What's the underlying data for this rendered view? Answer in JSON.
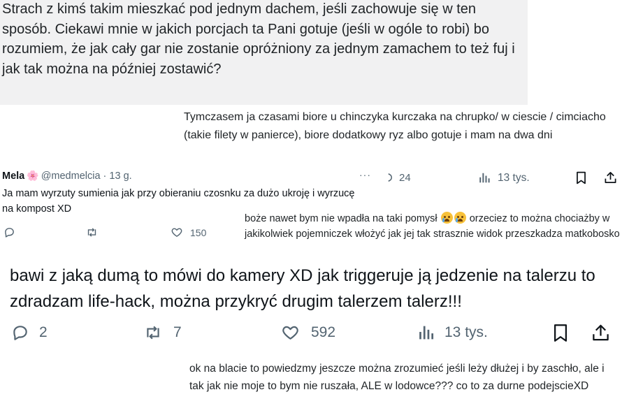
{
  "block1": {
    "text": "Strach z kimś takim mieszkać pod jednym dachem, jeśli zachowuje się w ten sposób. Ciekawi mnie w jakich porcjach ta Pani gotuje (jeśli w ogóle to robi) bo rozumiem, że jak cały gar nie zostanie opróżniony za jednym zamachem to też fuj i jak tak można na później zostawić?"
  },
  "block2": {
    "text": "Tymczasem ja czasami biore u chinczyka kurczaka na chrupko/ w ciescie / cimciacho (takie filety w panierce), biore dodatkowy ryz albo gotuje i mam na dwa dni"
  },
  "tweet_mela": {
    "name": "Mela",
    "flower": "🌸",
    "handle": "@medmelcia",
    "separator": "·",
    "time": "13 g.",
    "more": "···",
    "text": "Ja mam wyrzuty sumienia jak przy obieraniu czosnku za dużo ukroję i wyrzucę na kompost XD",
    "likes": "150"
  },
  "right_strip": {
    "replies": "24",
    "views": "13 tys."
  },
  "block5": {
    "text_before": "boże nawet bym nie wpadła na taki pomysł",
    "text_after": "orzeciez to można chociażby w jakikolwiek pojemniczek włożyć jak jej tak strasznie widok przeszkadza matkobosko"
  },
  "big_tweet": {
    "text": "bawi z jaką dumą to mówi do kamery XD jak triggeruje ją jedzenie na talerzu to zdradzam life-hack, można przykryć drugim talerzem talerz!!!",
    "replies": "2",
    "reposts": "7",
    "likes": "592",
    "views": "13 tys."
  },
  "block7": {
    "text": "ok na blacie to powiedzmy jeszcze można zrozumieć jeśli leży dłużej i by zaschło, ale i tak jak nie moje to bym nie ruszała, ALE w lodowce??? co to za durne podejscieXD"
  },
  "colors": {
    "muted": "#536471",
    "text": "#0f1419",
    "gray_bg": "#f1f1f2"
  }
}
